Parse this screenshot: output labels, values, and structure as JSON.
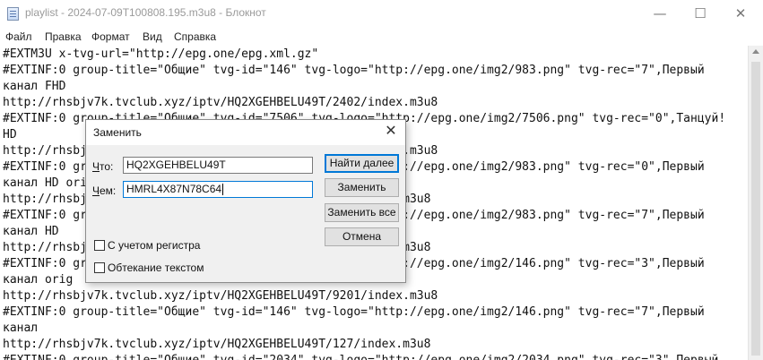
{
  "window": {
    "title": "playlist - 2024-07-09T100808.195.m3u8 - Блокнот",
    "controls": {
      "minimize": "—",
      "maximize": "☐",
      "close": "✕"
    }
  },
  "menu": [
    "Файл",
    "Правка",
    "Формат",
    "Вид",
    "Справка"
  ],
  "editor_lines": [
    "#EXTM3U x-tvg-url=\"http://epg.one/epg.xml.gz\"",
    "#EXTINF:0 group-title=\"Общие\" tvg-id=\"146\" tvg-logo=\"http://epg.one/img2/983.png\" tvg-rec=\"7\",Первый",
    "канал FHD",
    "http://rhsbjv7k.tvclub.xyz/iptv/HQ2XGEHBELU49T/2402/index.m3u8",
    "#EXTINF:0 group-title=\"Общие\" tvg-id=\"7506\" tvg-logo=\"http://epg.one/img2/7506.png\" tvg-rec=\"0\",Танцуй!",
    "HD",
    "http://rhsbjv7k.tvclub.xyz/iptv/HQ2XGEHBELU49T/7506/index.m3u8",
    "#EXTINF:0 group-title=\"Общие\" tvg-id=\"983\" tvg-logo=\"http://epg.one/img2/983.png\" tvg-rec=\"0\",Первый",
    "канал HD orig",
    "http://rhsbjv7k.tvclub.xyz/iptv/HQ2XGEHBELU49T/983/index.m3u8",
    "#EXTINF:0 group-title=\"Общие\" tvg-id=\"983\" tvg-logo=\"http://epg.one/img2/983.png\" tvg-rec=\"7\",Первый",
    "канал HD",
    "http://rhsbjv7k.tvclub.xyz/iptv/HQ2XGEHBELU49T/983/index.m3u8",
    "#EXTINF:0 group-title=\"Общие\" tvg-id=\"146\" tvg-logo=\"http://epg.one/img2/146.png\" tvg-rec=\"3\",Первый",
    "канал orig",
    "http://rhsbjv7k.tvclub.xyz/iptv/HQ2XGEHBELU49T/9201/index.m3u8",
    "#EXTINF:0 group-title=\"Общие\" tvg-id=\"146\" tvg-logo=\"http://epg.one/img2/146.png\" tvg-rec=\"7\",Первый",
    "канал",
    "http://rhsbjv7k.tvclub.xyz/iptv/HQ2XGEHBELU49T/127/index.m3u8",
    "#EXTINF:0 group-title=\"Общие\" tvg-id=\"2034\" tvg-logo=\"http://epg.one/img2/2034.png\" tvg-rec=\"3\",Первый"
  ],
  "replace_dialog": {
    "title": "Заменить",
    "close": "✕",
    "find_label_underlined": "Ч",
    "find_label_rest": "то:",
    "find_value": "HQ2XGEHBELU49T",
    "replace_label_underlined": "Ч",
    "replace_label_rest": "ем:",
    "replace_value": "HMRL4X87N78C64",
    "buttons": {
      "find_next": "Найти далее",
      "replace": "Заменить",
      "replace_all": "Заменить все",
      "cancel": "Отмена"
    },
    "match_case": "С учетом регистра",
    "wrap_around": "Обтекание текстом"
  }
}
